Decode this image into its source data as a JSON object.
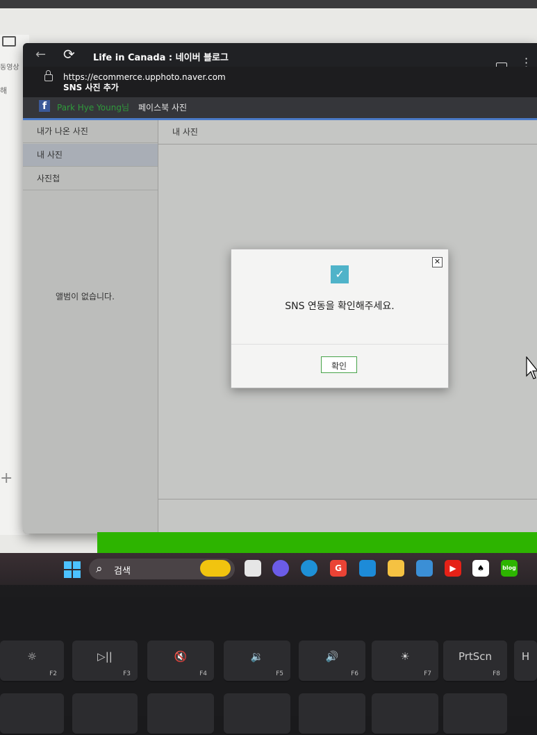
{
  "background_page": {
    "video_label": "동영상",
    "partial_text": "해"
  },
  "browser": {
    "title": "Life in Canada : 네이버 블로그",
    "url": "https://ecommerce.upphoto.naver.com",
    "page_title": "SNS 사진 추가"
  },
  "facebook_bar": {
    "icon": "f",
    "user_name": "Park Hye Young님",
    "section_title": "페이스북 사진"
  },
  "sidebar": {
    "items": [
      {
        "label": "내가 나온 사진"
      },
      {
        "label": "내 사진"
      },
      {
        "label": "사진첩"
      }
    ],
    "empty_message": "앨범이 없습니다."
  },
  "main": {
    "header": "내 사진"
  },
  "dialog": {
    "close_symbol": "✕",
    "check_symbol": "✓",
    "message": "SNS 연동을 확인해주세요.",
    "ok_label": "확인"
  },
  "taskbar": {
    "search_label": "검색",
    "blog_label": "blog",
    "gmail_label": "G"
  },
  "keyboard": {
    "keys": [
      {
        "main": "☼",
        "fn": "F2"
      },
      {
        "main": "▷||",
        "fn": "F3"
      },
      {
        "main": "🔇",
        "fn": "F4"
      },
      {
        "main": "🔉",
        "fn": "F5"
      },
      {
        "main": "🔊",
        "fn": "F6"
      },
      {
        "main": "☀",
        "fn": "F7"
      },
      {
        "main": "PrtScn",
        "fn": "F8"
      },
      {
        "main": "H",
        "fn": ""
      }
    ]
  },
  "colors": {
    "dialog_check": "#4fb3c9",
    "ok_border": "#46a348",
    "facebook_name": "#2f9a3b",
    "naver_green": "#2db400",
    "facebook_blue": "#3b5998"
  }
}
